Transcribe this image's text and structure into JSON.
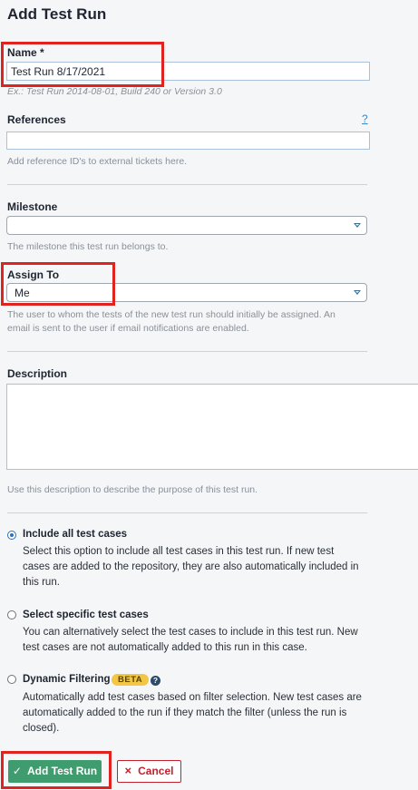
{
  "title": "Add Test Run",
  "name": {
    "label": "Name *",
    "value": "Test Run 8/17/2021",
    "hint": "Ex.: Test Run 2014-08-01, Build 240 or Version 3.0"
  },
  "references": {
    "label": "References",
    "help": "?",
    "value": "",
    "hint": "Add reference ID's to external tickets here."
  },
  "milestone": {
    "label": "Milestone",
    "value": "",
    "hint": "The milestone this test run belongs to."
  },
  "assign_to": {
    "label": "Assign To",
    "value": "Me",
    "hint_line1": "The user to whom the tests of the new test run should initially be assigned. An",
    "hint_line2": "email is sent to the user if email notifications are enabled."
  },
  "description": {
    "label": "Description",
    "value": "",
    "hint": "Use this description to describe the purpose of this test run."
  },
  "options": [
    {
      "title": "Include all test cases",
      "lines": [
        "Select this option to include all test cases in this test run. If new test",
        "cases are added to the repository, they are also automatically included in",
        "this run."
      ],
      "checked": true
    },
    {
      "title": "Select specific test cases",
      "lines": [
        "You can alternatively select the test cases to include in this test run. New",
        "test cases are not automatically added to this run in this case."
      ],
      "checked": false
    },
    {
      "title": "Dynamic Filtering",
      "badge": "BETA",
      "help": "?",
      "lines": [
        "Automatically add test cases based on filter selection. New test cases are",
        "automatically added to the run if they match the filter (unless the run is",
        "closed)."
      ],
      "checked": false
    }
  ],
  "buttons": {
    "submit_icon": "✓",
    "submit_label": "Add Test Run",
    "cancel_icon": "×",
    "cancel_label": "Cancel"
  },
  "colors": {
    "primary": "#3f9c6e",
    "cancel": "#c2222e",
    "highlight": "#e0231e",
    "radio": "#2f6fb3"
  }
}
